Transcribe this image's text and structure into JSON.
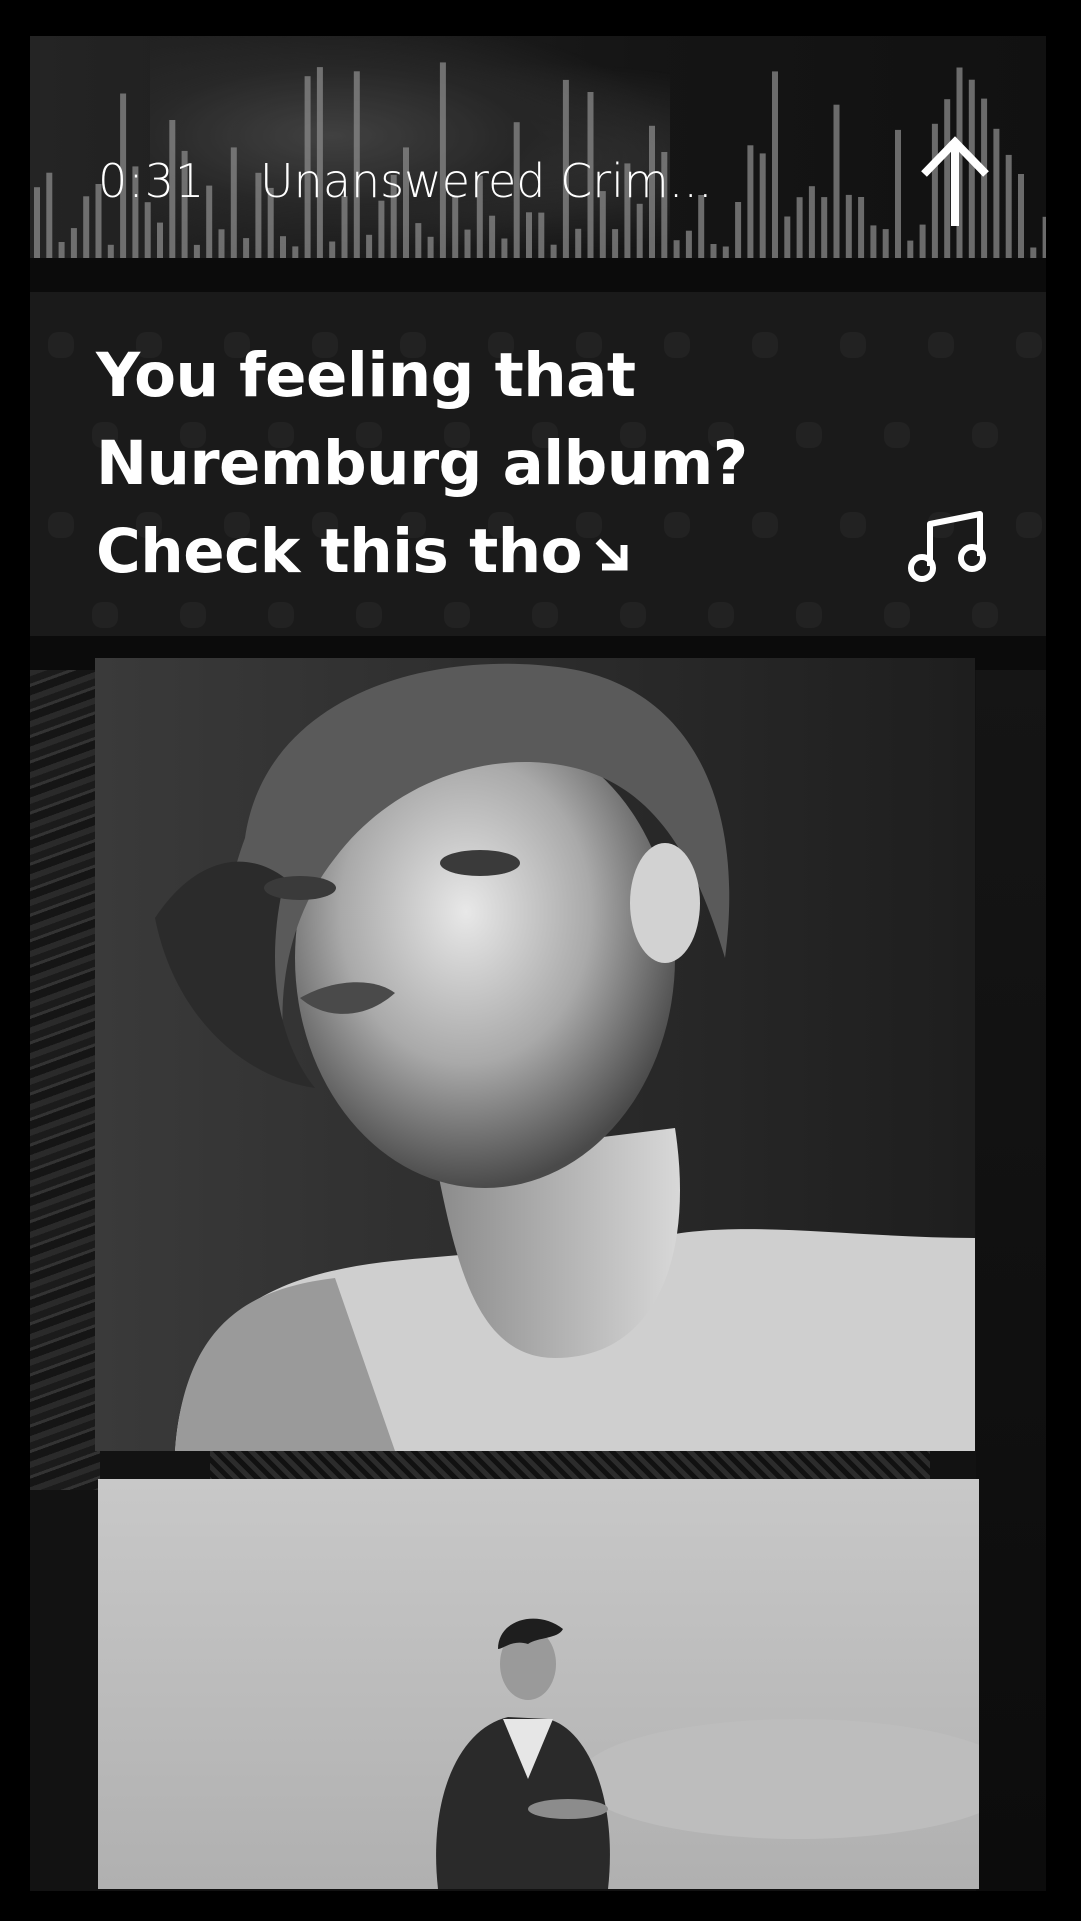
{
  "player": {
    "elapsed": "0:31",
    "track_title": "Unanswered Crim...",
    "expand_icon": "arrow-up-icon"
  },
  "message_card": {
    "lines": [
      "You feeling that",
      "Nuremburg album?",
      "Check this tho"
    ],
    "trailing_icon": "arrow-down-right-icon",
    "action_icon": "music-note-icon"
  },
  "gallery": {
    "items": [
      {
        "subject": "portrait-woman-turtleneck"
      },
      {
        "subject": "man-in-suit-against-sky"
      }
    ]
  },
  "colors": {
    "background": "#000000",
    "card": "#1a1a1a",
    "text": "#ffffff",
    "waveform": "#8a8a8a"
  }
}
